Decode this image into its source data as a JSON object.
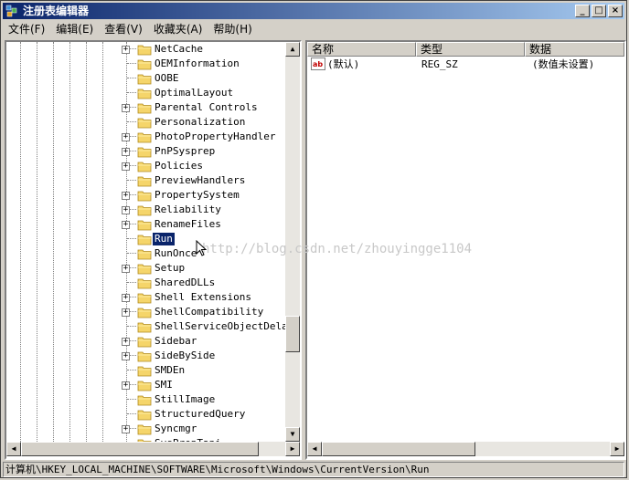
{
  "window": {
    "title": "注册表编辑器"
  },
  "menu": {
    "items": [
      "文件(F)",
      "编辑(E)",
      "查看(V)",
      "收藏夹(A)",
      "帮助(H)"
    ]
  },
  "tree": {
    "items": [
      {
        "label": "NetCache",
        "expandable": true
      },
      {
        "label": "OEMInformation",
        "expandable": false
      },
      {
        "label": "OOBE",
        "expandable": false
      },
      {
        "label": "OptimalLayout",
        "expandable": false
      },
      {
        "label": "Parental Controls",
        "expandable": true
      },
      {
        "label": "Personalization",
        "expandable": false
      },
      {
        "label": "PhotoPropertyHandler",
        "expandable": true
      },
      {
        "label": "PnPSysprep",
        "expandable": true
      },
      {
        "label": "Policies",
        "expandable": true
      },
      {
        "label": "PreviewHandlers",
        "expandable": false
      },
      {
        "label": "PropertySystem",
        "expandable": true
      },
      {
        "label": "Reliability",
        "expandable": true
      },
      {
        "label": "RenameFiles",
        "expandable": true
      },
      {
        "label": "Run",
        "expandable": false,
        "selected": true
      },
      {
        "label": "RunOnce",
        "expandable": false
      },
      {
        "label": "Setup",
        "expandable": true
      },
      {
        "label": "SharedDLLs",
        "expandable": false
      },
      {
        "label": "Shell Extensions",
        "expandable": true
      },
      {
        "label": "ShellCompatibility",
        "expandable": true
      },
      {
        "label": "ShellServiceObjectDelayLo",
        "expandable": false
      },
      {
        "label": "Sidebar",
        "expandable": true
      },
      {
        "label": "SideBySide",
        "expandable": true
      },
      {
        "label": "SMDEn",
        "expandable": false
      },
      {
        "label": "SMI",
        "expandable": true
      },
      {
        "label": "StillImage",
        "expandable": false
      },
      {
        "label": "StructuredQuery",
        "expandable": false
      },
      {
        "label": "Syncmgr",
        "expandable": true
      },
      {
        "label": "SysPrepTapi",
        "expandable": false
      }
    ]
  },
  "list": {
    "columns": [
      "名称",
      "类型",
      "数据"
    ],
    "rows": [
      {
        "name": "(默认)",
        "type": "REG_SZ",
        "data": "(数值未设置)"
      }
    ]
  },
  "watermark": "http://blog.csdn.net/zhouyingge1104",
  "status": {
    "path": "计算机\\HKEY_LOCAL_MACHINE\\SOFTWARE\\Microsoft\\Windows\\CurrentVersion\\Run"
  },
  "colors": {
    "titlebar": "#0a246a",
    "selection": "#0a246a",
    "chrome": "#d4d0c8"
  }
}
